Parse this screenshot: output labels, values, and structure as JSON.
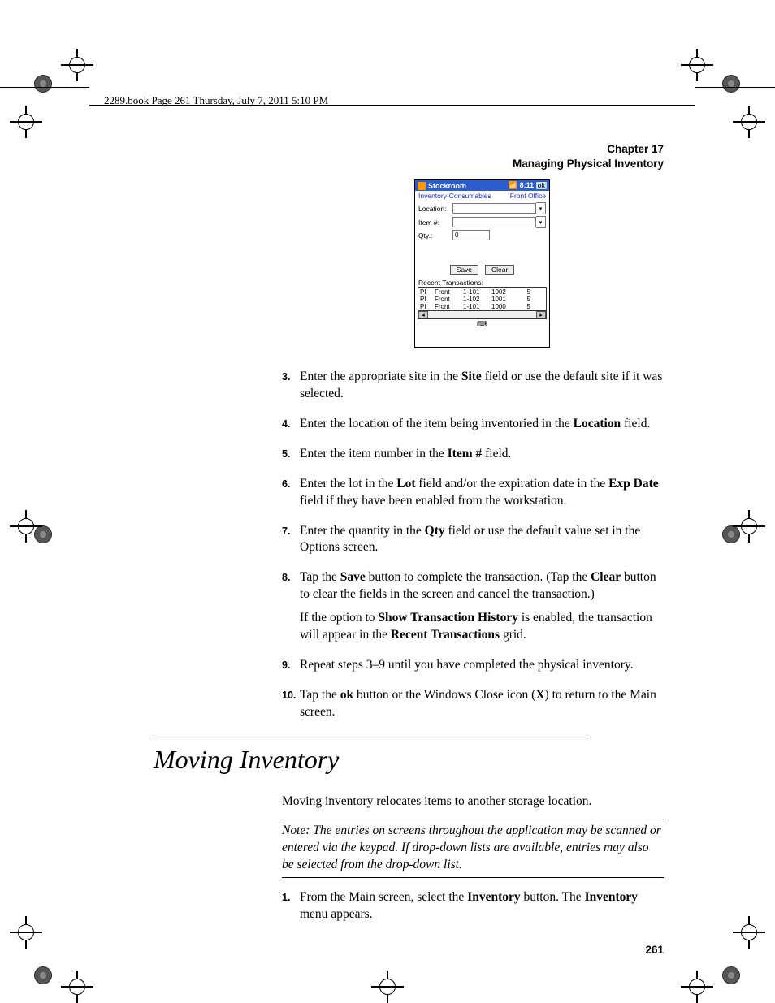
{
  "header": {
    "book_stamp": "2289.book  Page 261  Thursday, July 7, 2011  5:10 PM",
    "chapter_label": "Chapter 17",
    "chapter_title": "Managing Physical Inventory"
  },
  "screenshot": {
    "title": "Stockroom",
    "time": "8:11",
    "ok_label": "ok",
    "subtitle_left": "Inventory-Consumables",
    "subtitle_right": "Front Office",
    "labels": {
      "location": "Location:",
      "item": "Item #:",
      "qty": "Qty.:"
    },
    "qty_value": "0",
    "save_btn": "Save",
    "clear_btn": "Clear",
    "recent_label": "Recent Transactions:",
    "rows": [
      {
        "c1": "PI",
        "c2": "Front",
        "c3": "1-101",
        "c4": "1002",
        "c5": "5"
      },
      {
        "c1": "PI",
        "c2": "Front",
        "c3": "1-102",
        "c4": "1001",
        "c5": "5"
      },
      {
        "c1": "PI",
        "c2": "Front",
        "c3": "1-101",
        "c4": "1000",
        "c5": "5"
      }
    ]
  },
  "steps": {
    "s3": {
      "num": "3.",
      "t": "Enter the appropriate site in the ",
      "b1": "Site",
      "t2": " field or use the default site if it was selected."
    },
    "s4": {
      "num": "4.",
      "t": "Enter the location of the item being inventoried in the ",
      "b1": "Location",
      "t2": " field."
    },
    "s5": {
      "num": "5.",
      "t": "Enter the item number in the ",
      "b1": "Item #",
      "t2": " field."
    },
    "s6": {
      "num": "6.",
      "t": "Enter the lot in the ",
      "b1": "Lot",
      "t2": " field and/or the expiration date in the ",
      "b2": "Exp Date",
      "t3": " field if they have been enabled from the workstation."
    },
    "s7": {
      "num": "7.",
      "t": "Enter the quantity in the ",
      "b1": "Qty",
      "t2": " field or use the default value set in the Options screen."
    },
    "s8": {
      "num": "8.",
      "t": "Tap the ",
      "b1": "Save",
      "t2": " button to complete the transaction. (Tap the ",
      "b2": "Clear",
      "t3": " button to clear the fields in the screen and cancel the transaction.)",
      "p2a": "If the option to ",
      "p2b": "Show Transaction History",
      "p2c": " is enabled, the transaction will appear in the ",
      "p2d": "Recent Transactions",
      "p2e": " grid."
    },
    "s9": {
      "num": "9.",
      "t": "Repeat steps 3–9 until you have completed the physical inventory."
    },
    "s10": {
      "num": "10.",
      "t": "Tap the ",
      "b1": "ok",
      "t2": " button or the Windows Close icon (",
      "b2": "X",
      "t3": ") to return to the Main screen."
    }
  },
  "section": {
    "title": "Moving Inventory",
    "intro": "Moving inventory relocates items to another storage location.",
    "note": "Note:   The entries on screens throughout the application may be scanned or entered via the keypad. If drop-down lists are available, entries may also be selected from the drop-down list.",
    "step1": {
      "num": "1.",
      "t": "From the Main screen, select the ",
      "b1": "Inventory",
      "t2": " button. The ",
      "b2": "Inventory",
      "t3": " menu appears."
    }
  },
  "page_number": "261"
}
